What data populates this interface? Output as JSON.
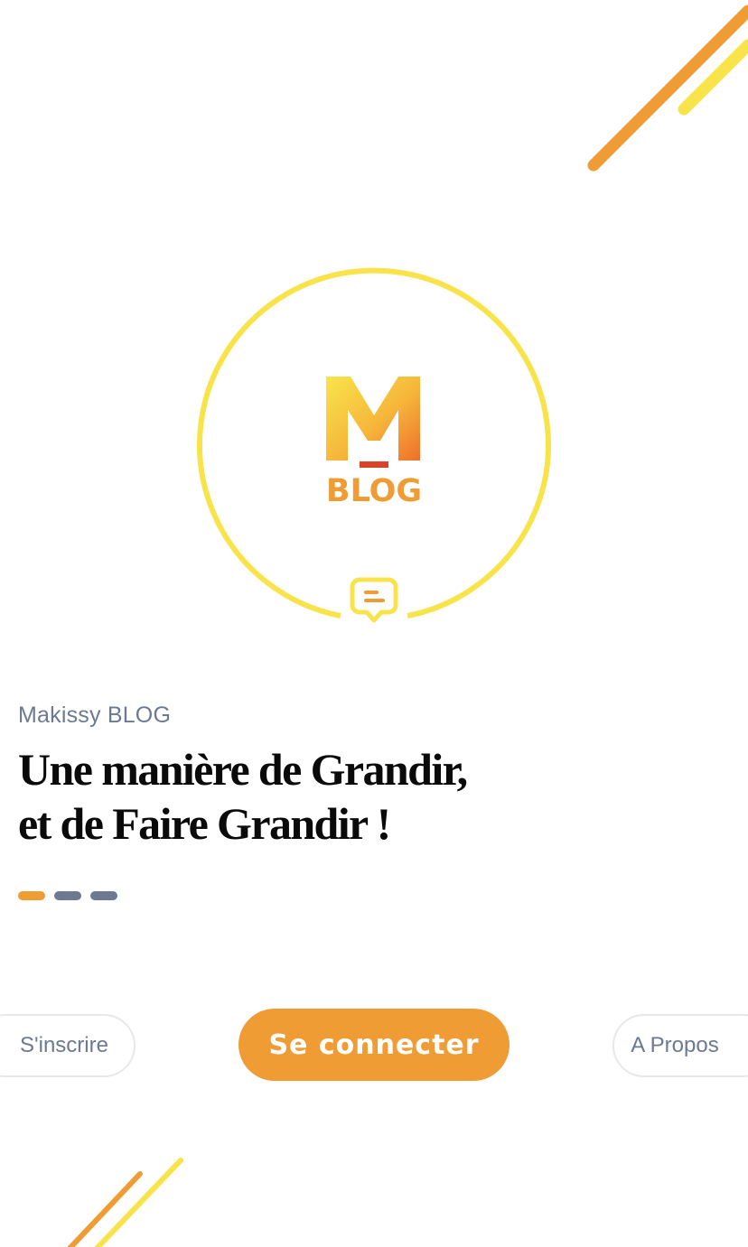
{
  "colors": {
    "orange": "#f09c35",
    "yellow": "#f8e44a",
    "slate": "#6b7a92",
    "dark_red": "#d9432b"
  },
  "logo": {
    "brand_text": "BLOG",
    "icon": "m-blog-logo",
    "ring_badge_icon": "chat-bubble-icon"
  },
  "app_name": "Makissy BLOG",
  "headline": {
    "line1": "Une manière de Grandir,",
    "line2": "et de Faire Grandir !"
  },
  "carousel": {
    "active_index": 0,
    "total": 3
  },
  "buttons": {
    "signup": "S'inscrire",
    "login": "Se connecter",
    "about": "A Propos"
  }
}
